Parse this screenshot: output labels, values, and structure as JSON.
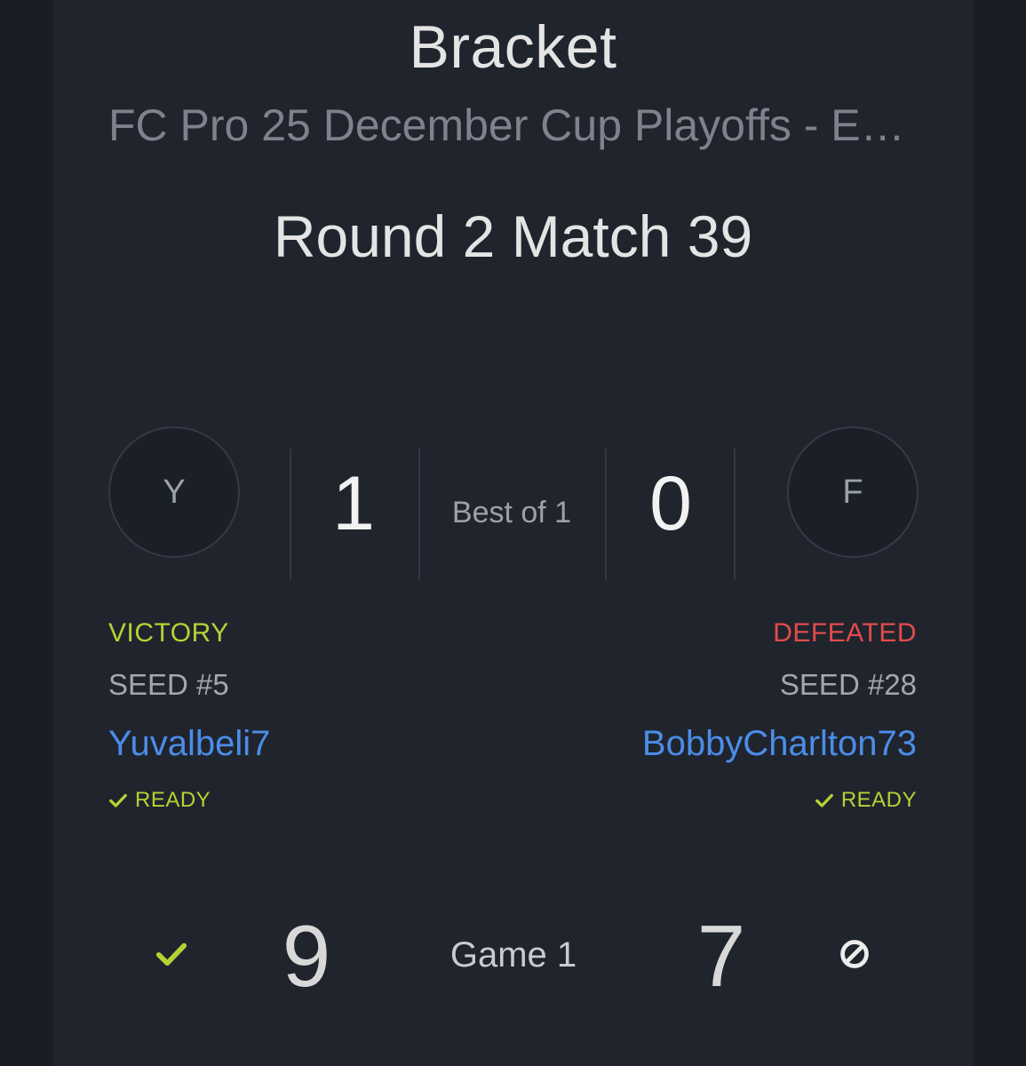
{
  "header": {
    "title": "Bracket",
    "subtitle": "FC Pro 25 December Cup Playoffs - E…",
    "round": "Round 2 Match 39"
  },
  "match": {
    "best_of": "Best of 1",
    "left": {
      "avatar_letter": "Y",
      "score": "1",
      "result": "VICTORY",
      "seed": "SEED #5",
      "name": "Yuvalbeli7",
      "ready": "READY"
    },
    "right": {
      "avatar_letter": "F",
      "score": "0",
      "result": "DEFEATED",
      "seed": "SEED #28",
      "name": "BobbyCharlton73",
      "ready": "READY"
    }
  },
  "games": [
    {
      "label": "Game 1",
      "left_score": "9",
      "right_score": "7",
      "left_icon": "check-icon",
      "right_icon": "no-entry-icon"
    }
  ],
  "colors": {
    "background": "#1a1d24",
    "panel": "#20242d",
    "victory": "#b3d335",
    "defeated": "#e34b4b",
    "player_link": "#4b8de8"
  }
}
